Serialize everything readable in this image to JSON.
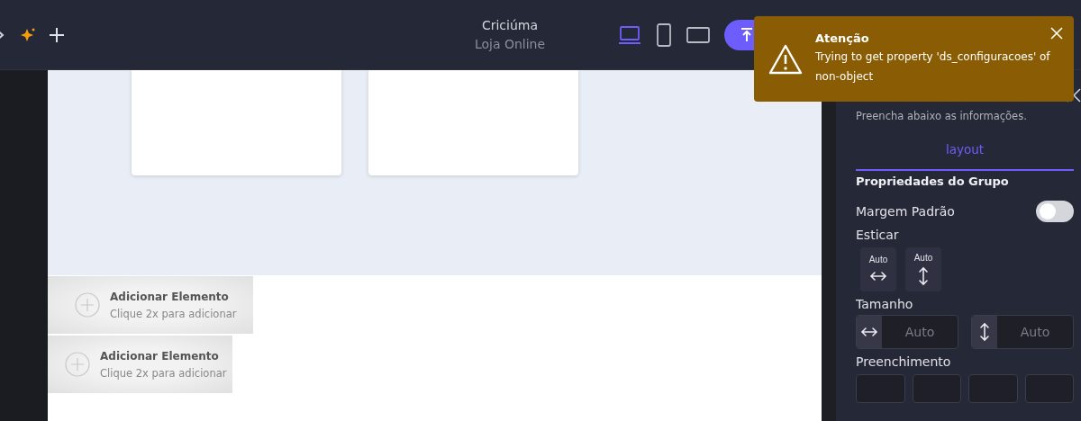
{
  "header": {
    "title": "Criciúma",
    "subtitle": "Loja Online",
    "devices": [
      {
        "kind": "desktop",
        "selected": true
      },
      {
        "kind": "phone",
        "selected": false
      },
      {
        "kind": "tablet",
        "selected": false
      }
    ]
  },
  "toast": {
    "title": "Atenção",
    "message": "Trying to get property 'ds_configuracoes' of non-object"
  },
  "canvas": {
    "add_elements": [
      {
        "title": "Adicionar Elemento",
        "hint": "Clique 2x para adicionar"
      },
      {
        "title": "Adicionar Elemento",
        "hint": "Clique 2x para adicionar"
      }
    ]
  },
  "panel": {
    "subtitle": "Preencha abaixo as informações.",
    "tabs": [
      {
        "label": "layout",
        "selected": true
      }
    ],
    "section": "Propriedades do Grupo",
    "toggle": {
      "label": "Margem Padrão",
      "on": false
    },
    "stretch": {
      "label": "Esticar",
      "options": [
        {
          "label": "Auto",
          "kind": "horizontal"
        },
        {
          "label": "Auto",
          "kind": "vertical"
        }
      ]
    },
    "size": {
      "label": "Tamanho",
      "fields": [
        {
          "kind": "horizontal",
          "placeholder": "Auto"
        },
        {
          "kind": "vertical",
          "placeholder": "Auto"
        }
      ]
    },
    "padding": {
      "label": "Preenchimento"
    }
  }
}
